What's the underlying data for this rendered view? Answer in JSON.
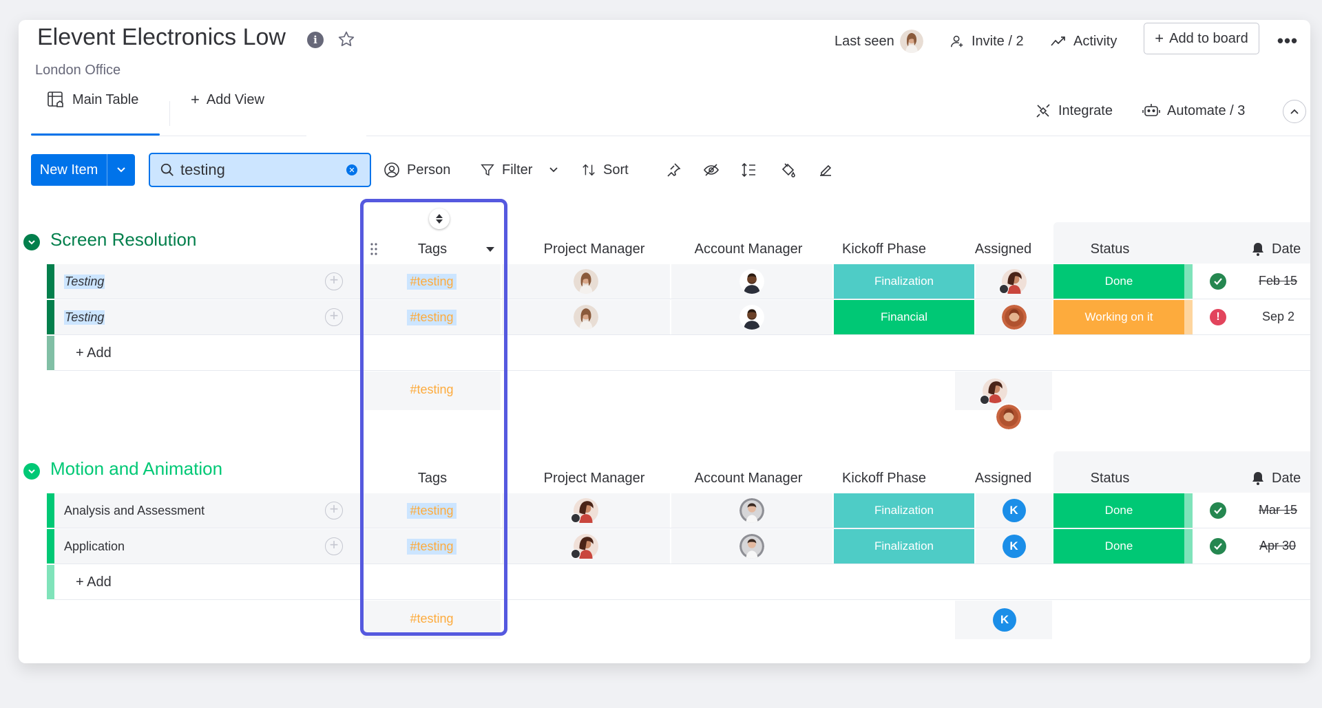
{
  "board": {
    "title": "Elevent Electronics Low",
    "subtitle": "London Office"
  },
  "header": {
    "last_seen_label": "Last seen",
    "invite_label": "Invite / 2",
    "activity_label": "Activity",
    "add_to_board_label": "Add to board"
  },
  "views": {
    "main_table_label": "Main Table",
    "add_view_label": "Add View",
    "integrate_label": "Integrate",
    "automate_label": "Automate / 3"
  },
  "toolbar": {
    "new_item_label": "New Item",
    "search_value": "testing",
    "person_label": "Person",
    "filter_label": "Filter",
    "sort_label": "Sort"
  },
  "columns": {
    "tags": "Tags",
    "project_manager": "Project Manager",
    "account_manager": "Account Manager",
    "kickoff_phase": "Kickoff Phase",
    "assigned": "Assigned",
    "status": "Status",
    "date": "Date"
  },
  "colors": {
    "accent": "#0073ea",
    "highlight_border": "#5559df",
    "group1": "#037f4c",
    "group2": "#00c875",
    "finalization": "#4eccc6",
    "financial": "#00c875",
    "done": "#00c875",
    "working_on_it": "#fdab3d",
    "tag_text": "#fdab3d"
  },
  "groups": [
    {
      "title": "Screen Resolution",
      "add_label": "+ Add",
      "summary_tag": "#testing",
      "rows": [
        {
          "name": "Testing",
          "tag": "#testing",
          "kickoff": "Finalization",
          "status": "Done",
          "date": "Feb 15",
          "date_icon": "check-icon"
        },
        {
          "name": "Testing",
          "tag": "#testing",
          "kickoff": "Financial",
          "status": "Working on it",
          "date": "Sep 2",
          "date_icon": "alert-icon"
        }
      ]
    },
    {
      "title": "Motion and Animation",
      "add_label": "+ Add",
      "summary_tag": "#testing",
      "summary_assigned": "K",
      "rows": [
        {
          "name": "Analysis and Assessment",
          "tag": "#testing",
          "kickoff": "Finalization",
          "status": "Done",
          "date": "Mar 15",
          "date_icon": "check-icon",
          "assigned": "K"
        },
        {
          "name": "Application",
          "tag": "#testing",
          "kickoff": "Finalization",
          "status": "Done",
          "date": "Apr 30",
          "date_icon": "check-icon",
          "assigned": "K"
        }
      ]
    }
  ]
}
